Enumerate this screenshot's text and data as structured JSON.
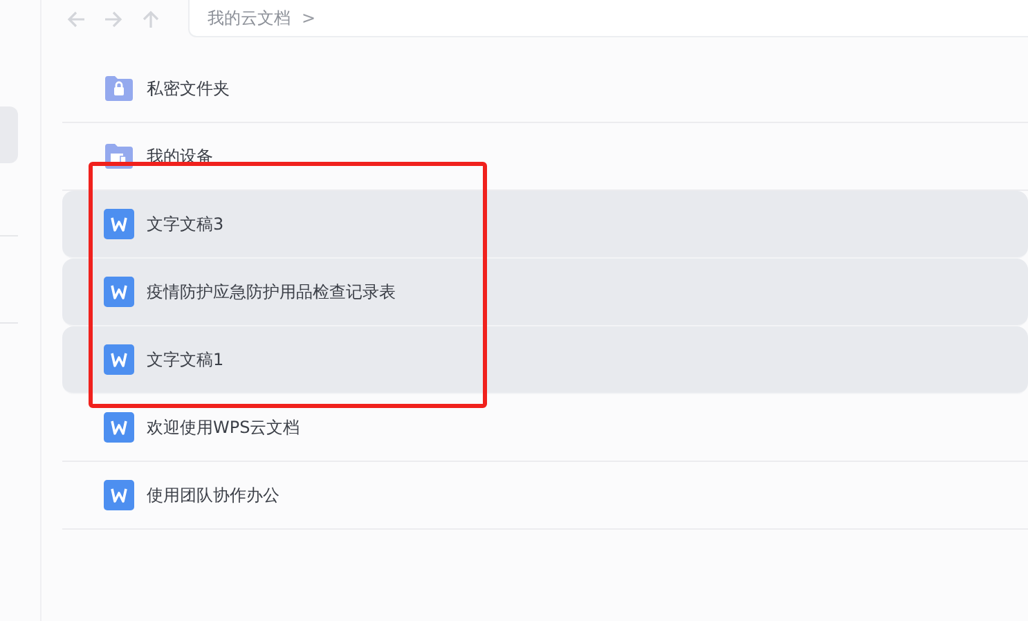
{
  "breadcrumb": {
    "path": "我的云文档",
    "separator": ">"
  },
  "files": [
    {
      "kind": "lock-folder",
      "name": "私密文件夹",
      "selected": false
    },
    {
      "kind": "device-folder",
      "name": "我的设备",
      "selected": false
    },
    {
      "kind": "doc",
      "name": "文字文稿3",
      "selected": true
    },
    {
      "kind": "doc",
      "name": "疫情防护应急防护用品检查记录表",
      "selected": true
    },
    {
      "kind": "doc",
      "name": "文字文稿1",
      "selected": true
    },
    {
      "kind": "doc",
      "name": "欢迎使用WPS云文档",
      "selected": false
    },
    {
      "kind": "doc",
      "name": "使用团队协作办公",
      "selected": false
    }
  ]
}
